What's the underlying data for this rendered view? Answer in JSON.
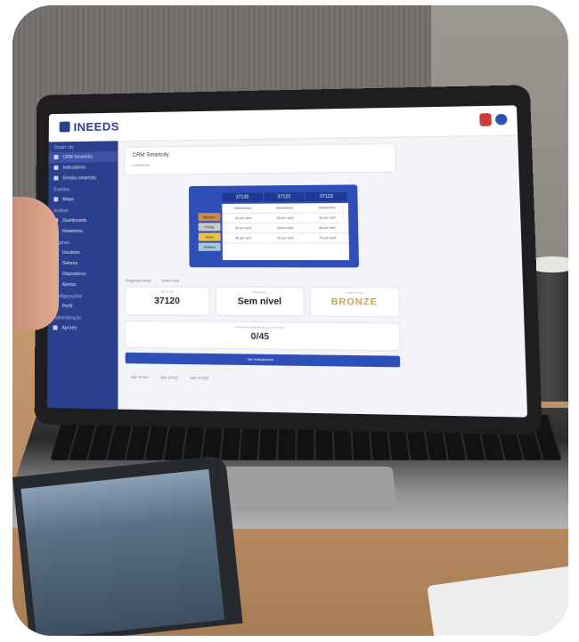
{
  "app": {
    "brand": "INEEDS"
  },
  "sidebar": {
    "sections": [
      {
        "head": "Smart city",
        "items": [
          "CRM Smartcity",
          "Indicadores",
          "Gestão smartcity"
        ]
      },
      {
        "head": "Eventos",
        "items": [
          "Mapa"
        ]
      },
      {
        "head": "Análise",
        "items": [
          "Dashboards",
          "Relatórios"
        ]
      },
      {
        "head": "Páginas",
        "items": [
          "Usuários",
          "Setores",
          "Dispositivos",
          "Alertas"
        ]
      },
      {
        "head": "Configurações",
        "items": [
          "Perfil"
        ]
      },
      {
        "head": "Administração",
        "items": [
          "Api key"
        ]
      }
    ]
  },
  "page": {
    "title": "CRM Smartcity",
    "subtitle": "• Smartcity"
  },
  "levels_table": {
    "columns": [
      "37120",
      "37122",
      "37123"
    ],
    "subheader": "Indicadores",
    "levels": [
      {
        "name": "Bronze",
        "color": "#c98a4b"
      },
      {
        "name": "Prata",
        "color": "#c9c9c9"
      },
      {
        "name": "Ouro",
        "color": "#e6c24a"
      },
      {
        "name": "Platina",
        "color": "#a9c6d6"
      }
    ],
    "rows": [
      [
        "Indicadores",
        "Indicadores",
        "Indicadores"
      ],
      [
        "16 por cent",
        "36 por cent",
        "36 por cent"
      ],
      [
        "36 por cent",
        "36 por cent",
        "36 por cent"
      ],
      [
        "36 por cent",
        "76 por cent",
        "76 por cent"
      ]
    ]
  },
  "tabs": [
    "Progresso Atual",
    "Outro nível"
  ],
  "stats": [
    {
      "key": "ISO 37120",
      "value": "37120"
    },
    {
      "key": "Nível atual",
      "value": "Sem nível"
    },
    {
      "key": "Próximo nível",
      "value": "BRONZE"
    }
  ],
  "progress": {
    "key": "Indicadores para atingir o próximo nível",
    "value": "0/45"
  },
  "action_button": "Ver indicadores",
  "norms": [
    "ISO 37120",
    "ISO 37122",
    "ISO 37123"
  ]
}
